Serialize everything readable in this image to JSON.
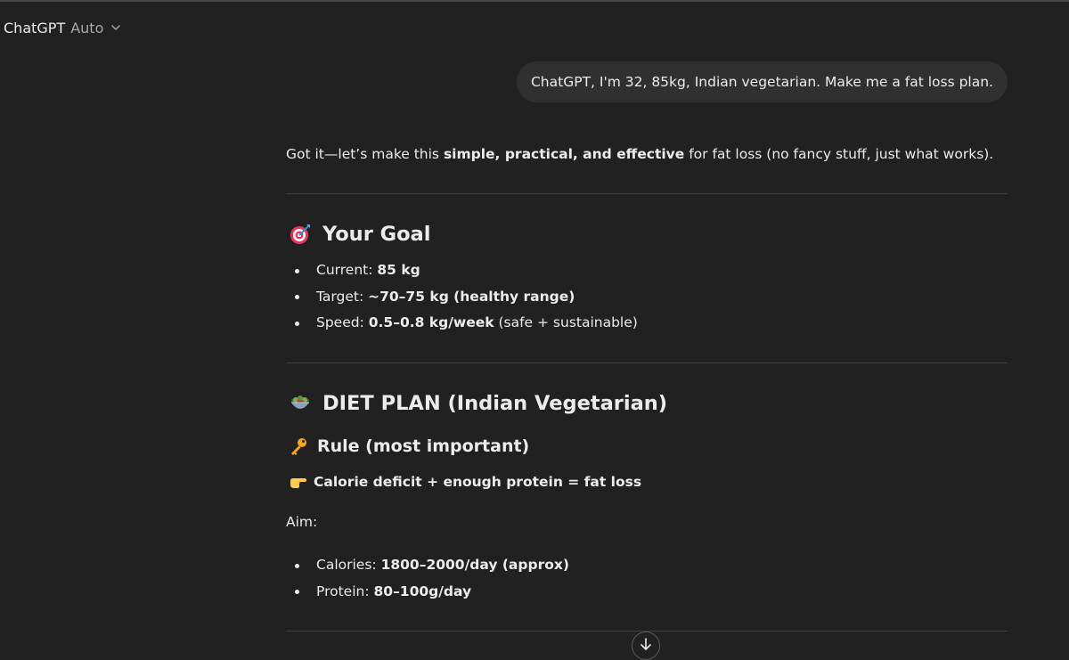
{
  "header": {
    "model_name": "ChatGPT",
    "model_mode": "Auto",
    "chevron_icon": "chevron-down-icon"
  },
  "user_message": "ChatGPT, I'm 32, 85kg, Indian vegetarian. Make me a fat loss plan.",
  "response": {
    "intro": {
      "prefix": "Got it—let’s make this ",
      "bold": "simple, practical, and effective",
      "suffix": " for fat loss (no fancy stuff, just what works)."
    },
    "goal_section": {
      "emoji": "direct-hit-emoji",
      "title": "Your Goal",
      "items": [
        {
          "label": "Current: ",
          "bold": "85 kg",
          "rest": ""
        },
        {
          "label": "Target: ",
          "bold": "~70–75 kg (healthy range)",
          "rest": ""
        },
        {
          "label": "Speed: ",
          "bold": "0.5–0.8 kg/week",
          "rest": " (safe + sustainable)"
        }
      ]
    },
    "diet_section": {
      "emoji": "green-salad-emoji",
      "title": "DIET PLAN (Indian Vegetarian)",
      "rule": {
        "emoji": "key-emoji",
        "title": "Rule (most important)"
      },
      "callout": {
        "emoji": "pointing-right-emoji",
        "text": "Calorie deficit + enough protein = fat loss"
      },
      "aim_label": "Aim:",
      "aim_items": [
        {
          "label": "Calories: ",
          "bold": "1800–2000/day (approx)"
        },
        {
          "label": "Protein: ",
          "bold": "80–100g/day"
        }
      ]
    }
  },
  "scroll_down_icon": "arrow-down-icon"
}
